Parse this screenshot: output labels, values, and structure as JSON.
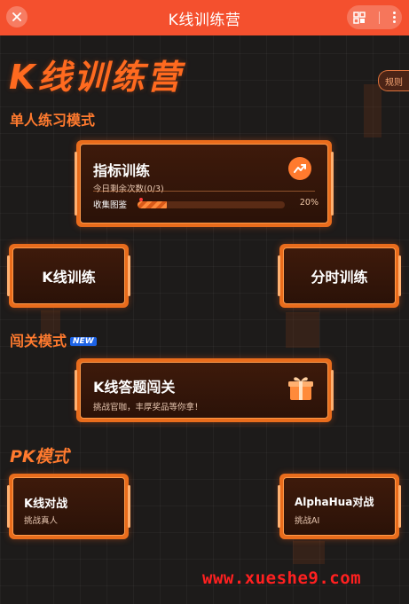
{
  "header": {
    "title": "K线训练营"
  },
  "hero": {
    "title": "K线训练营"
  },
  "rules_label": "规则",
  "sections": {
    "single": "单人练习模式",
    "challenge": "闯关模式",
    "challenge_badge": "NEW",
    "pk": "PK模式"
  },
  "indicator_card": {
    "title": "指标训练",
    "remaining": "今日剩余次数(0/3)",
    "collect_label": "收集图鉴",
    "progress_text": "20%",
    "progress_percent": 20,
    "icon": "trend-icon"
  },
  "kline_training": {
    "label": "K线训练"
  },
  "timeshare_training": {
    "label": "分时训练"
  },
  "quiz_card": {
    "title": "K线答题闯关",
    "subtitle": "挑战官咖，丰厚奖品等你拿！",
    "icon": "gift-icon"
  },
  "pk_kline": {
    "title": "K线对战",
    "subtitle": "挑战真人"
  },
  "pk_ai": {
    "title": "AlphaHua对战",
    "subtitle": "挑战AI"
  },
  "watermark": "www.xueshe9.com",
  "colors": {
    "topbar": "#f4502e",
    "accent": "#ff7a2e",
    "background": "#1d1b1a",
    "card_border": "#e96c1c"
  }
}
